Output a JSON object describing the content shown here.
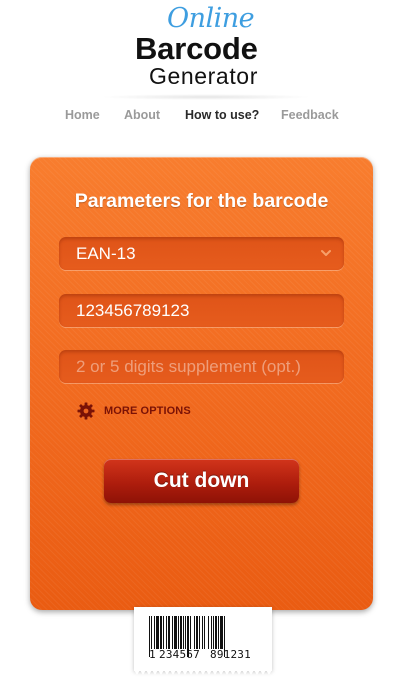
{
  "logo": {
    "online": "Online",
    "barcode": "Barcode",
    "generator": "Generator"
  },
  "nav": {
    "items": [
      {
        "label": "Home",
        "active": false
      },
      {
        "label": "About",
        "active": false
      },
      {
        "label": "How to use?",
        "active": true
      },
      {
        "label": "Feedback",
        "active": false
      }
    ]
  },
  "panel": {
    "title": "Parameters for the barcode",
    "barcode_type": {
      "value": "EAN-13",
      "icon": "chevron-down-icon"
    },
    "code_input": {
      "value": "123456789123"
    },
    "supplement_input": {
      "placeholder": "2 or 5 digits supplement (opt.)",
      "value": ""
    },
    "more_options": {
      "label": "MORE OPTIONS",
      "icon": "gear-icon"
    },
    "submit_label": "Cut down"
  },
  "barcode_preview": {
    "first_digit": "1",
    "left_group": "234567",
    "right_group": "891231"
  },
  "colors": {
    "panel_orange": "#f26a1d",
    "button_red": "#ae1d0d",
    "logo_blue": "#3e9ee0",
    "more_options_text": "#7a1206"
  }
}
